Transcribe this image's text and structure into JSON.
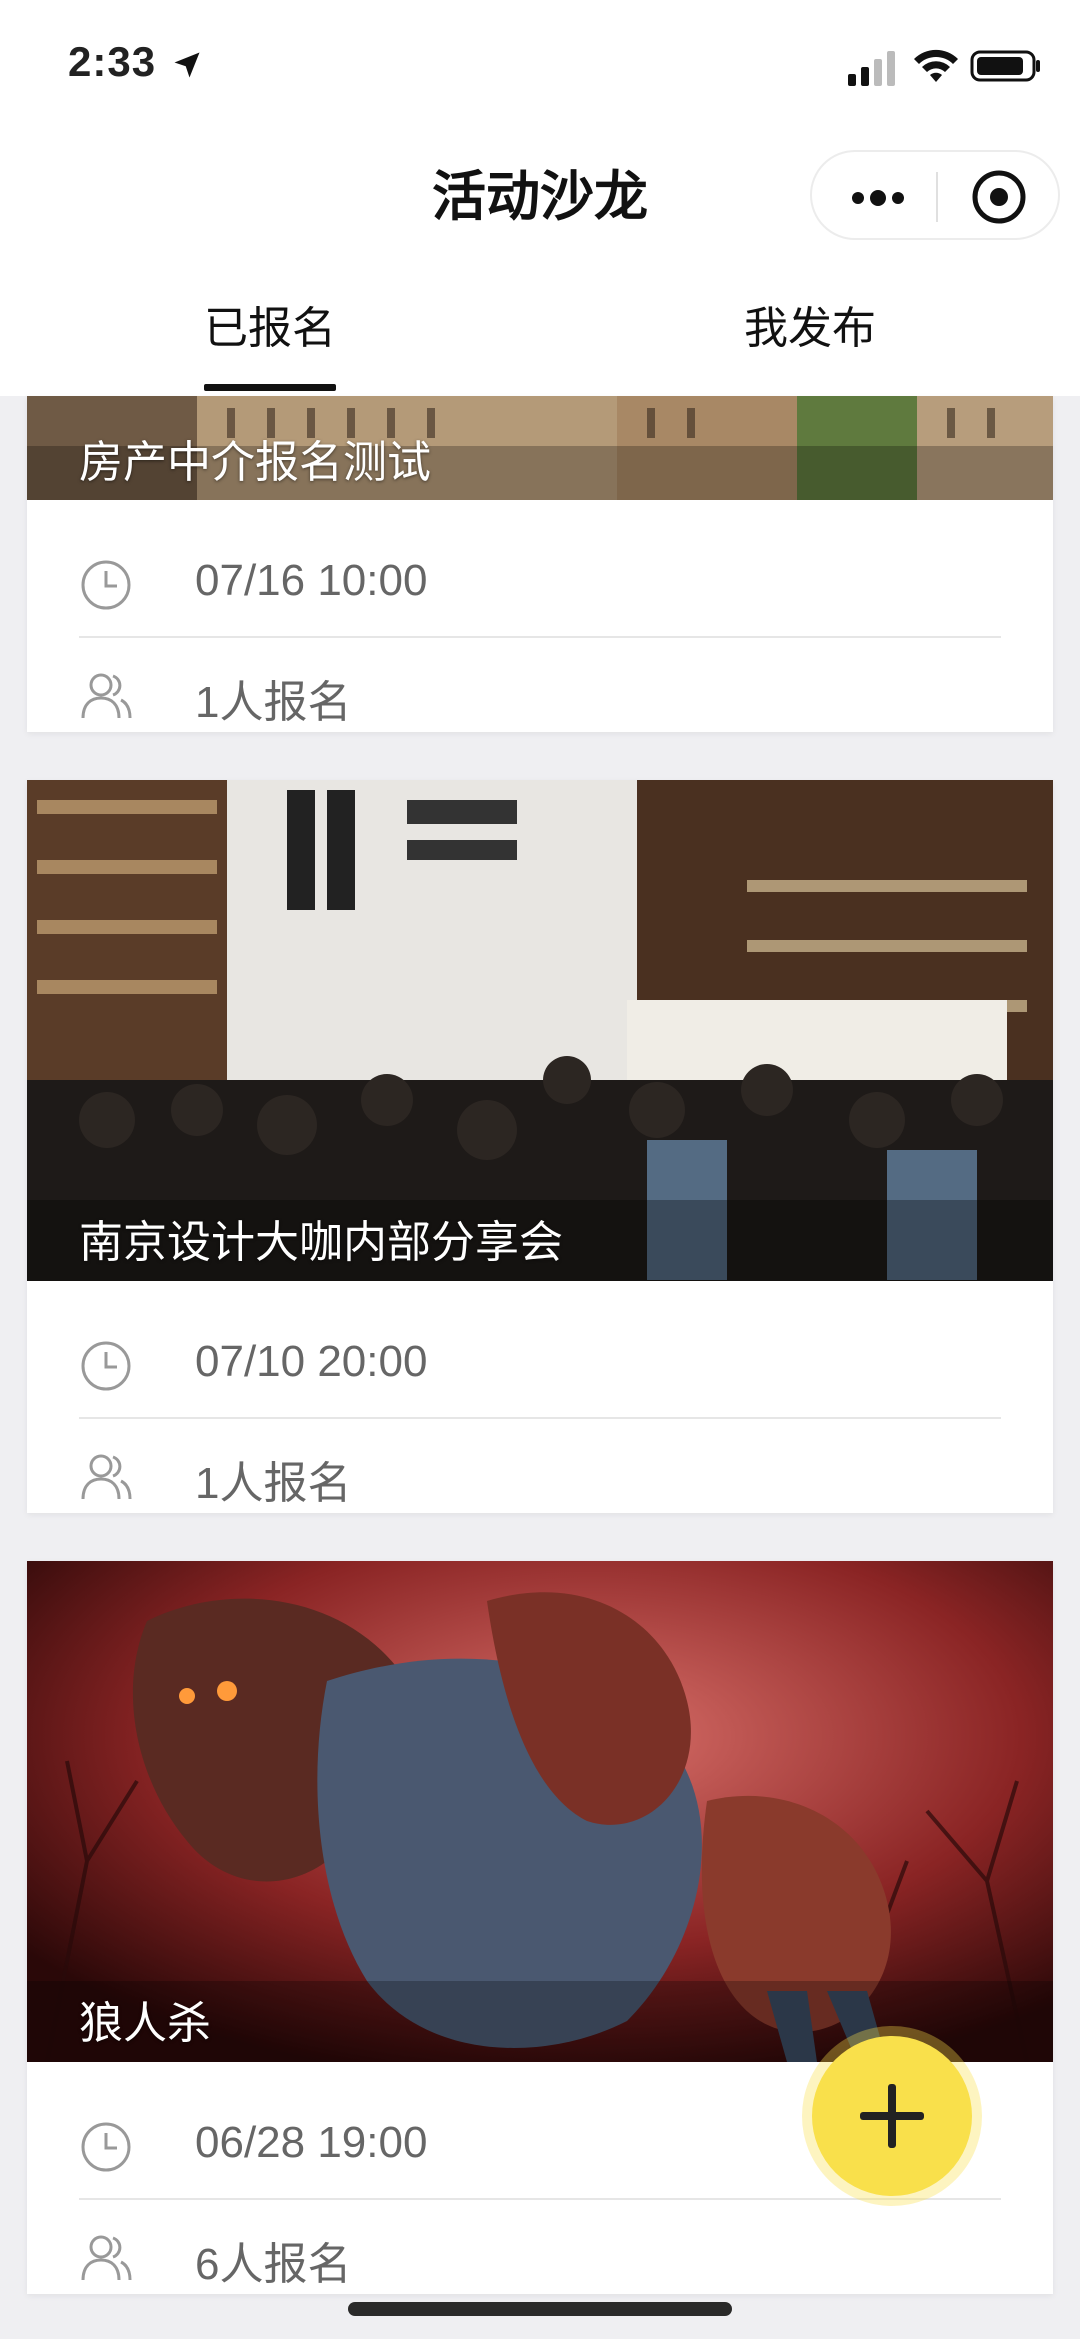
{
  "status_bar": {
    "time": "2:33"
  },
  "nav": {
    "title": "活动沙龙"
  },
  "tabs": [
    {
      "label": "已报名",
      "active": true
    },
    {
      "label": "我发布",
      "active": false
    }
  ],
  "events": [
    {
      "title": "房产中介报名测试",
      "datetime": "07/16 10:00",
      "signups": "1人报名"
    },
    {
      "title": "南京设计大咖内部分享会",
      "datetime": "07/10 20:00",
      "signups": "1人报名"
    },
    {
      "title": "狼人杀",
      "datetime": "06/28 19:00",
      "signups": "6人报名"
    }
  ],
  "colors": {
    "accent_fab": "#f9e04b",
    "text_secondary": "#666666",
    "divider": "#e6e6e6"
  }
}
